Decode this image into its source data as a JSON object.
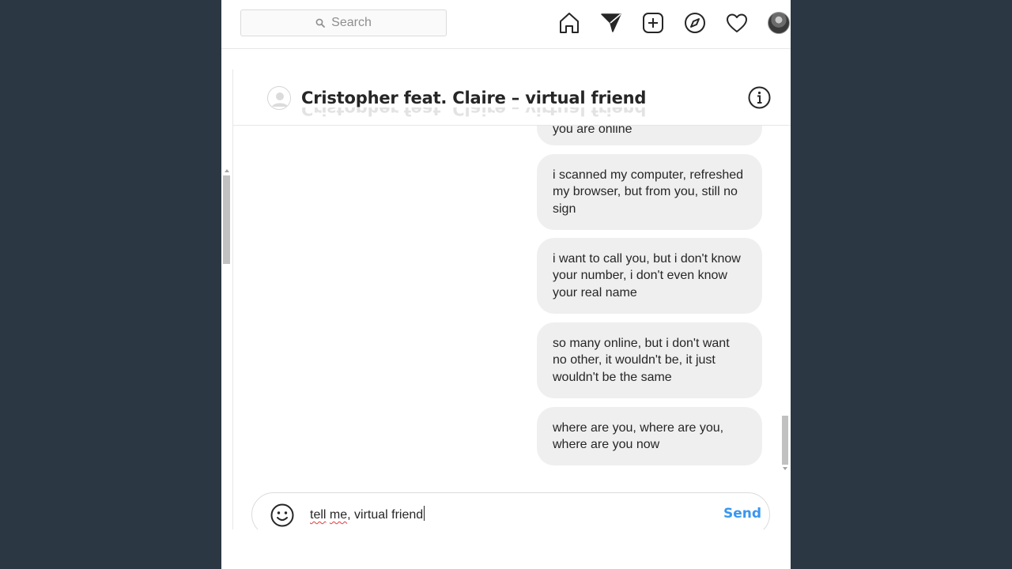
{
  "topnav": {
    "search_placeholder": "Search",
    "icons": [
      "home-icon",
      "direct-send-icon",
      "new-post-icon",
      "explore-compass-icon",
      "activity-heart-icon",
      "profile-avatar"
    ]
  },
  "chat": {
    "title": "Cristopher feat. Claire – virtual friend",
    "messages": [
      {
        "text": "you are online"
      },
      {
        "text": "i scanned my computer, refreshed my browser, but from you, still no sign"
      },
      {
        "text": "i want to call you, but i don't know your number, i don't even know your real name"
      },
      {
        "text": "so many online, but i don't want no other, it wouldn't be, it just wouldn't be the same"
      },
      {
        "text": "where are you, where are you, where are you now"
      }
    ]
  },
  "composer": {
    "input_word1": "tell",
    "input_word2": "me",
    "input_rest": ", virtual friend",
    "send_label": "Send"
  },
  "colors": {
    "desktop_bg": "#2b3844",
    "bubble_bg": "#efefef",
    "accent": "#3897f0"
  }
}
